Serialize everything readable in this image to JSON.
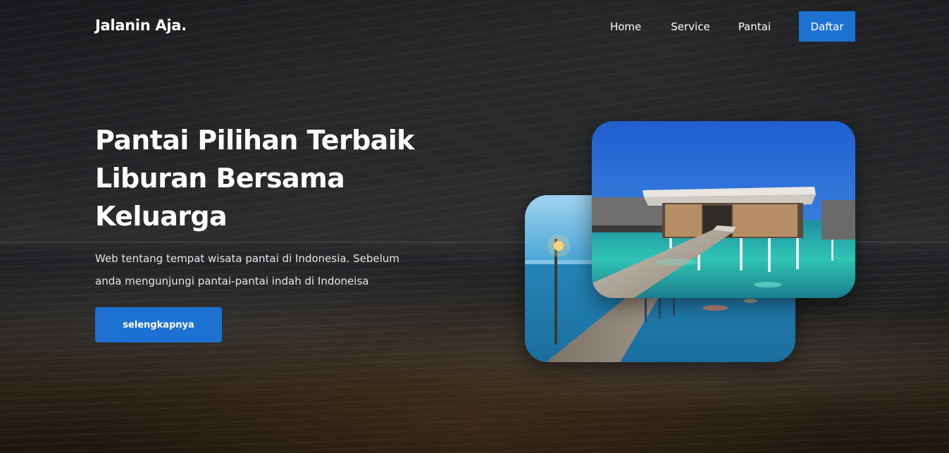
{
  "brand": {
    "logo_text": "Jalanin Aja."
  },
  "nav": {
    "items": [
      {
        "label": "Home"
      },
      {
        "label": "Service"
      },
      {
        "label": "Pantai"
      }
    ],
    "cta_label": "Daftar",
    "cta_color": "#1d72d1"
  },
  "hero": {
    "headline_lines": [
      "Pantai Pilihan Terbaik",
      "Liburan Bersama",
      "Keluarga"
    ],
    "description_lines": [
      "Web tentang tempat wisata pantai di Indonesia. Sebelum",
      "anda mengunjungi pantai-pantai indah di Indoneisa"
    ],
    "button_label": "selengkapnya",
    "button_color": "#1d72d1"
  },
  "gallery": {
    "photos": [
      {
        "name": "overwater-walkway-dusk-photo"
      },
      {
        "name": "overwater-villa-photo"
      }
    ]
  }
}
